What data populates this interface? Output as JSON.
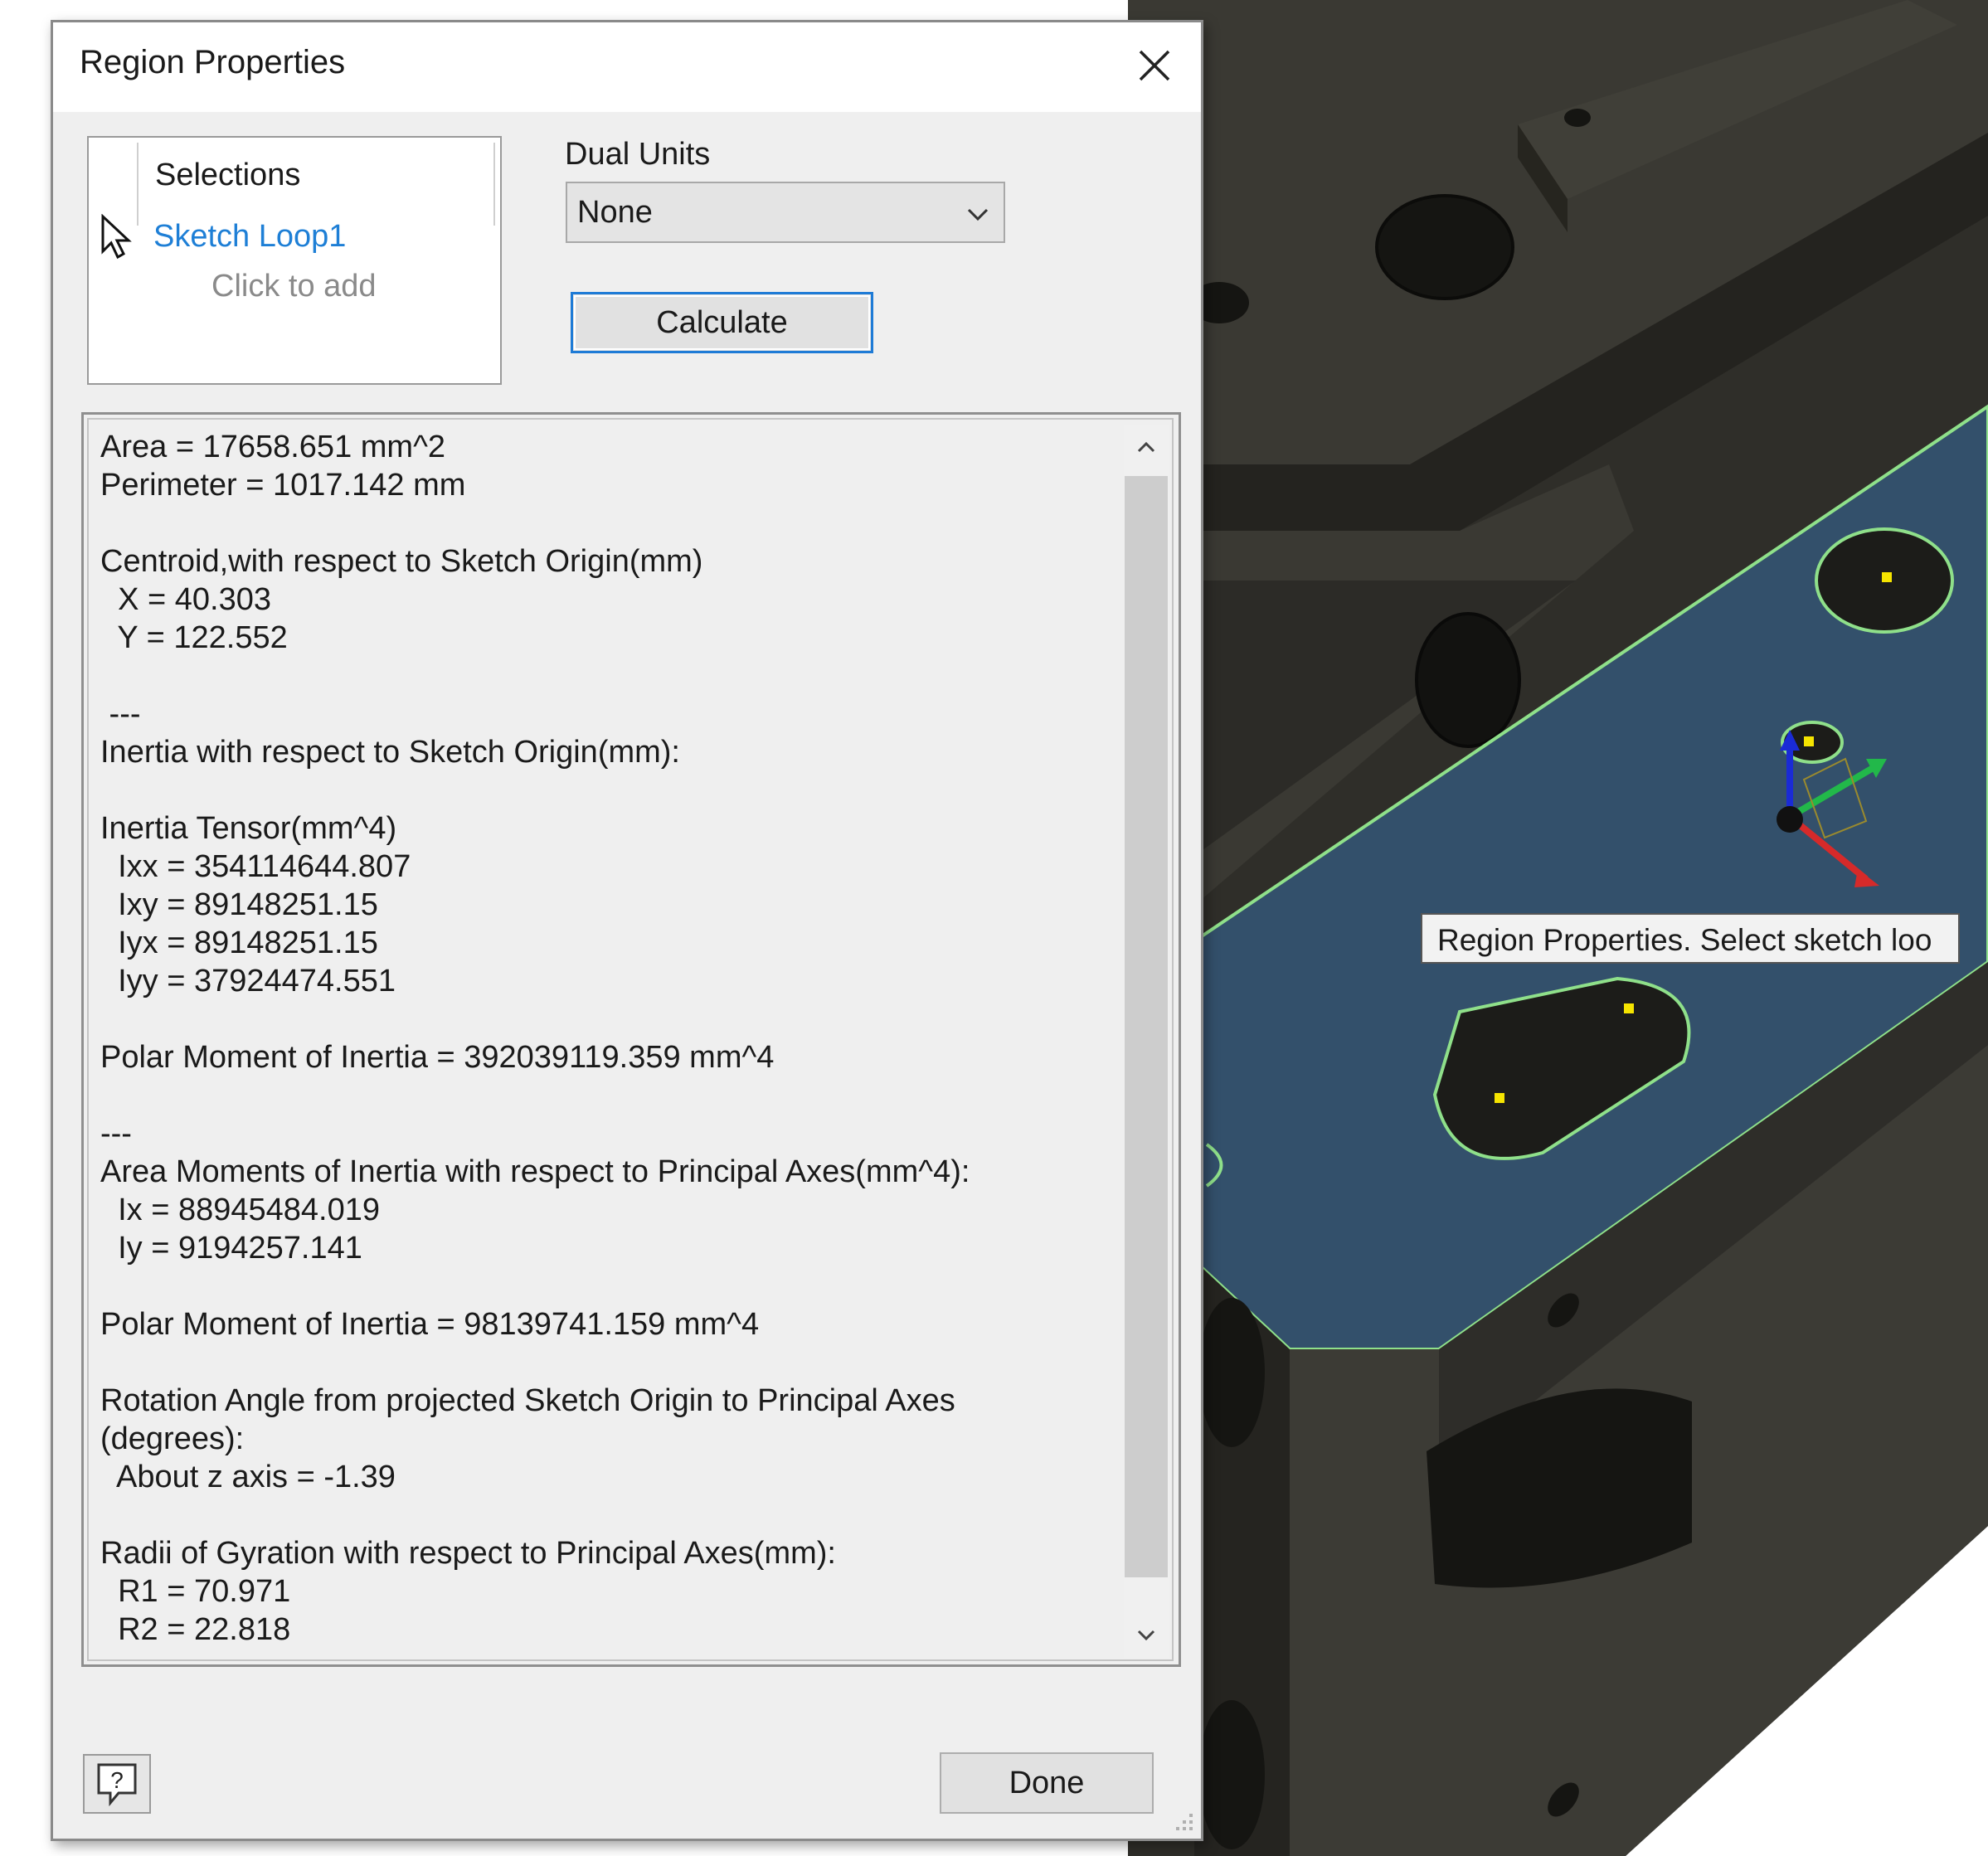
{
  "dialog": {
    "title": "Region Properties",
    "close_icon": "close-icon",
    "selections": {
      "header": "Selections",
      "item": "Sketch Loop1",
      "add_prompt": "Click to add"
    },
    "dual_units": {
      "label": "Dual Units",
      "value": "None"
    },
    "calculate_label": "Calculate",
    "results_text": "Area = 17658.651 mm^2\nPerimeter = 1017.142 mm\n\nCentroid,with respect to Sketch Origin(mm)\n  X = 40.303\n  Y = 122.552\n\n ---\nInertia with respect to Sketch Origin(mm):\n\nInertia Tensor(mm^4)\n  Ixx = 354114644.807\n  Ixy = 89148251.15\n  Iyx = 89148251.15\n  Iyy = 37924474.551\n\nPolar Moment of Inertia = 392039119.359 mm^4\n\n---\nArea Moments of Inertia with respect to Principal Axes(mm^4):\n  Ix = 88945484.019\n  Iy = 9194257.141\n\nPolar Moment of Inertia = 98139741.159 mm^4\n\nRotation Angle from projected Sketch Origin to Principal Axes\n(degrees):\n  About z axis = -1.39\n\nRadii of Gyration with respect to Principal Axes(mm):\n  R1 = 70.971\n  R2 = 22.818",
    "done_label": "Done",
    "help_icon": "help-icon"
  },
  "viewport": {
    "tooltip": "Region Properties. Select sketch loo",
    "colors": {
      "background": "#2b2a26",
      "region_fill": "#33506b",
      "region_edge": "#8fe08a",
      "point": "#f5e400"
    }
  }
}
